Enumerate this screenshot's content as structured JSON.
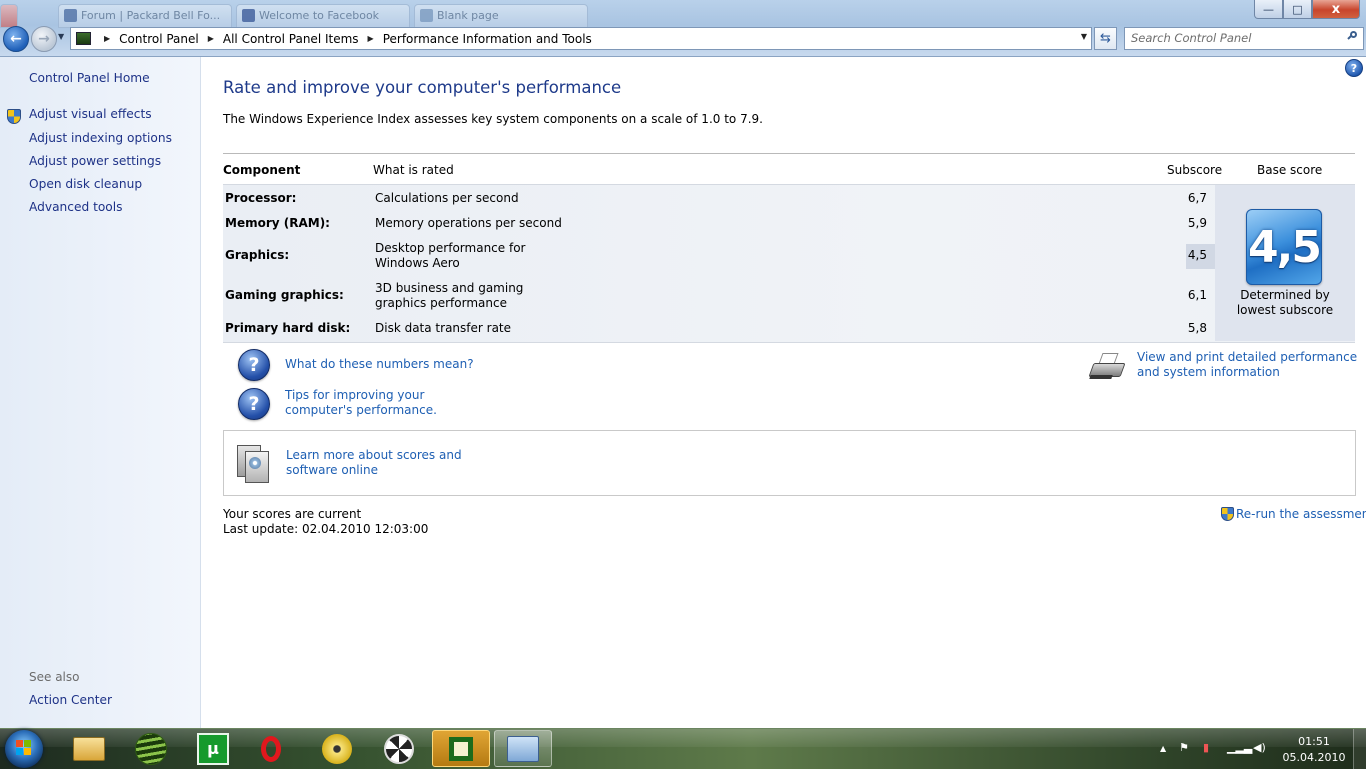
{
  "window": {
    "ghost_tabs": [
      "Forum | Packard Bell Fo...",
      "Welcome to Facebook",
      "Blank page"
    ],
    "buttons": {
      "minimize": "—",
      "maximize": "□",
      "close": "x"
    }
  },
  "address_bar": {
    "crumbs": [
      "Control Panel",
      "All Control Panel Items",
      "Performance Information and Tools"
    ]
  },
  "search": {
    "placeholder": "Search Control Panel"
  },
  "left_pane": {
    "home": "Control Panel Home",
    "links": [
      "Adjust visual effects",
      "Adjust indexing options",
      "Adjust power settings",
      "Open disk cleanup",
      "Advanced tools"
    ],
    "see_also_label": "See also",
    "see_also_links": [
      "Action Center"
    ]
  },
  "main": {
    "title": "Rate and improve your computer's performance",
    "description": "The Windows Experience Index assesses key system components on a scale of 1.0 to 7.9.",
    "headers": {
      "component": "Component",
      "what": "What is rated",
      "subscore": "Subscore",
      "base": "Base score"
    },
    "rows": [
      {
        "component": "Processor:",
        "what": "Calculations per second",
        "subscore": "6,7"
      },
      {
        "component": "Memory (RAM):",
        "what": "Memory operations per second",
        "subscore": "5,9"
      },
      {
        "component": "Graphics:",
        "what": "Desktop performance for Windows Aero",
        "subscore": "4,5"
      },
      {
        "component": "Gaming graphics:",
        "what": "3D business and gaming graphics performance",
        "subscore": "6,1"
      },
      {
        "component": "Primary hard disk:",
        "what": "Disk data transfer rate",
        "subscore": "5,8"
      }
    ],
    "base_score": "4,5",
    "base_caption": "Determined by lowest subscore",
    "help_links": {
      "numbers": "What do these numbers mean?",
      "tips": "Tips for improving your computer's performance.",
      "print": "View and print detailed performance and system information",
      "learn": "Learn more about scores and software online"
    },
    "status": "Your scores are current",
    "last_update": "Last update: 02.04.2010 12:03:00",
    "rerun": "Re-run the assessment"
  },
  "taskbar": {
    "pinned": [
      "explorer",
      "spotify",
      "utorrent",
      "opera",
      "disc-burner",
      "fan-control",
      "amd-vision",
      "control-panel"
    ],
    "time": "01:51",
    "date": "05.04.2010"
  },
  "colors": {
    "link": "#1e5fb3",
    "title": "#1e3a8a",
    "left_link": "#1e3287"
  }
}
